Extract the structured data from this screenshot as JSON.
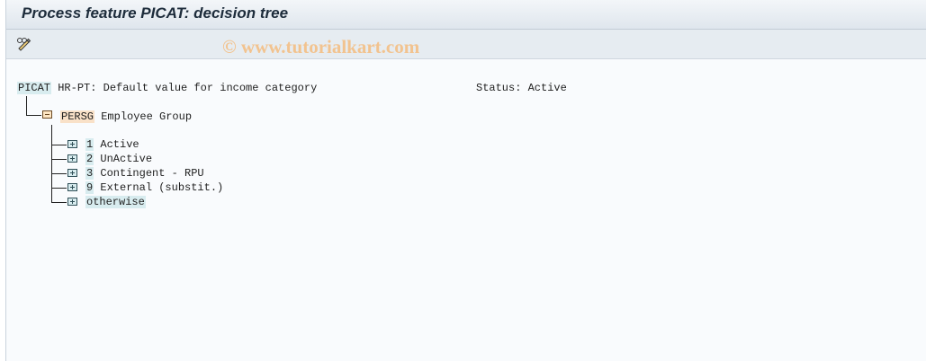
{
  "window": {
    "title": "Process feature PICAT: decision tree"
  },
  "toolbar": {
    "edit_icon": "pencil-glasses-icon",
    "watermark": "© www.tutorialkart.com"
  },
  "feature": {
    "key": "PICAT",
    "description": "HR-PT: Default value for income category",
    "status": "Status: Active"
  },
  "decision": {
    "key": "PERSG",
    "description": "Employee Group"
  },
  "branches": [
    {
      "key": "1",
      "label": "Active"
    },
    {
      "key": "2",
      "label": "UnActive"
    },
    {
      "key": "3",
      "label": "Contingent - RPU"
    },
    {
      "key": "9",
      "label": "External (substit.)"
    },
    {
      "key": "",
      "label": "otherwise"
    }
  ],
  "colors": {
    "key_highlight": "#d8ecef",
    "decision_highlight": "#f9e1c8",
    "watermark": "#f2c38f"
  }
}
